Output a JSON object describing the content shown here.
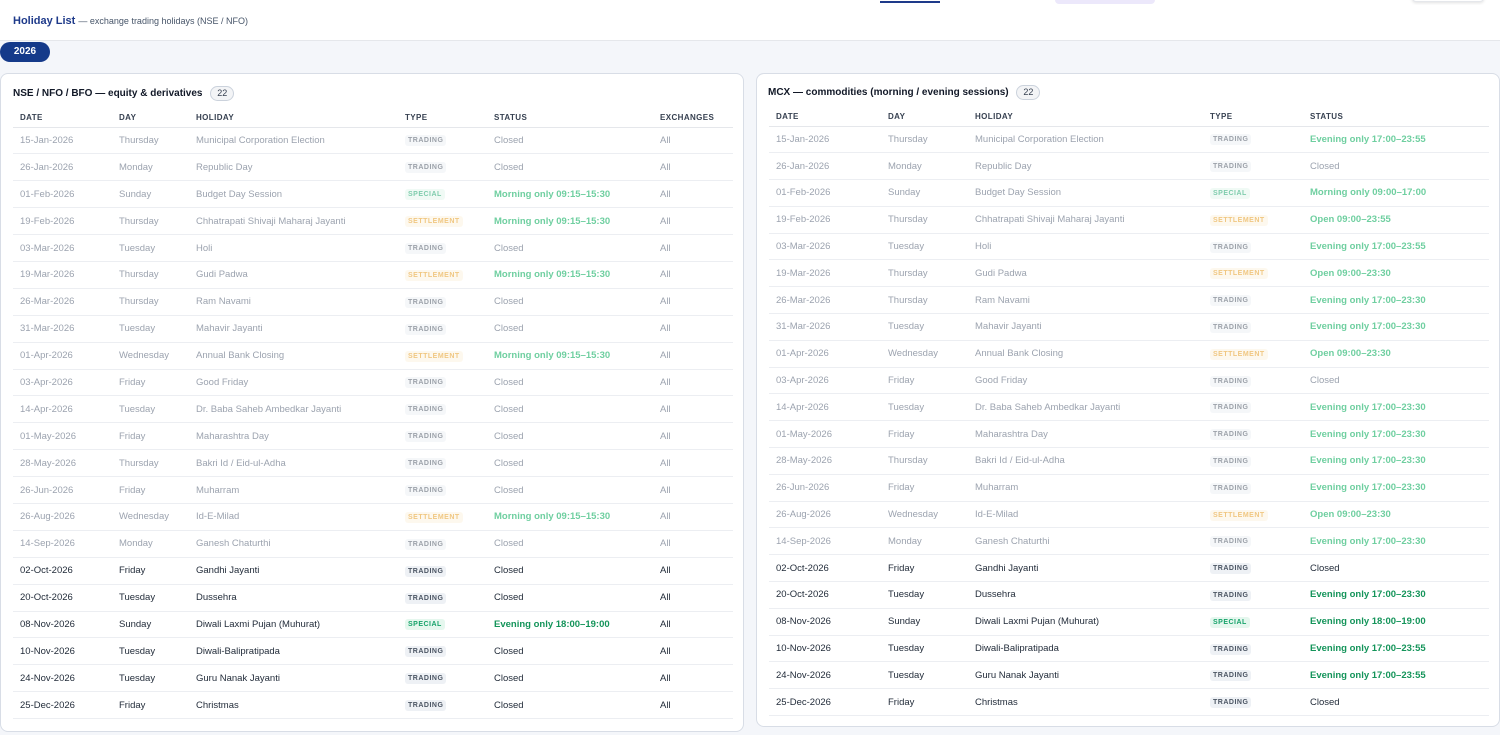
{
  "header": {
    "title": "Holiday List",
    "subtitle": "— exchange trading holidays (NSE / NFO)"
  },
  "year": "2026",
  "columns": {
    "date": "DATE",
    "day": "DAY",
    "holiday": "HOLIDAY",
    "type": "TYPE",
    "status": "STATUS",
    "exchanges": "EXCHANGES"
  },
  "nse": {
    "title": "NSE / NFO / BFO — equity & derivatives",
    "count": "22",
    "rows": [
      {
        "date": "15-Jan-2026",
        "day": "Thursday",
        "holiday": "Municipal Corporation Election",
        "type": "TRADING",
        "status": "Closed",
        "exchanges": "All",
        "past": true,
        "open": false
      },
      {
        "date": "26-Jan-2026",
        "day": "Monday",
        "holiday": "Republic Day",
        "type": "TRADING",
        "status": "Closed",
        "exchanges": "All",
        "past": true,
        "open": false
      },
      {
        "date": "01-Feb-2026",
        "day": "Sunday",
        "holiday": "Budget Day Session",
        "type": "SPECIAL",
        "status": "Morning only 09:15–15:30",
        "exchanges": "All",
        "past": true,
        "open": true
      },
      {
        "date": "19-Feb-2026",
        "day": "Thursday",
        "holiday": "Chhatrapati Shivaji Maharaj Jayanti",
        "type": "SETTLEMENT",
        "status": "Morning only 09:15–15:30",
        "exchanges": "All",
        "past": true,
        "open": true
      },
      {
        "date": "03-Mar-2026",
        "day": "Tuesday",
        "holiday": "Holi",
        "type": "TRADING",
        "status": "Closed",
        "exchanges": "All",
        "past": true,
        "open": false
      },
      {
        "date": "19-Mar-2026",
        "day": "Thursday",
        "holiday": "Gudi Padwa",
        "type": "SETTLEMENT",
        "status": "Morning only 09:15–15:30",
        "exchanges": "All",
        "past": true,
        "open": true
      },
      {
        "date": "26-Mar-2026",
        "day": "Thursday",
        "holiday": "Ram Navami",
        "type": "TRADING",
        "status": "Closed",
        "exchanges": "All",
        "past": true,
        "open": false
      },
      {
        "date": "31-Mar-2026",
        "day": "Tuesday",
        "holiday": "Mahavir Jayanti",
        "type": "TRADING",
        "status": "Closed",
        "exchanges": "All",
        "past": true,
        "open": false
      },
      {
        "date": "01-Apr-2026",
        "day": "Wednesday",
        "holiday": "Annual Bank Closing",
        "type": "SETTLEMENT",
        "status": "Morning only 09:15–15:30",
        "exchanges": "All",
        "past": true,
        "open": true
      },
      {
        "date": "03-Apr-2026",
        "day": "Friday",
        "holiday": "Good Friday",
        "type": "TRADING",
        "status": "Closed",
        "exchanges": "All",
        "past": true,
        "open": false
      },
      {
        "date": "14-Apr-2026",
        "day": "Tuesday",
        "holiday": "Dr. Baba Saheb Ambedkar Jayanti",
        "type": "TRADING",
        "status": "Closed",
        "exchanges": "All",
        "past": true,
        "open": false
      },
      {
        "date": "01-May-2026",
        "day": "Friday",
        "holiday": "Maharashtra Day",
        "type": "TRADING",
        "status": "Closed",
        "exchanges": "All",
        "past": true,
        "open": false
      },
      {
        "date": "28-May-2026",
        "day": "Thursday",
        "holiday": "Bakri Id / Eid-ul-Adha",
        "type": "TRADING",
        "status": "Closed",
        "exchanges": "All",
        "past": true,
        "open": false
      },
      {
        "date": "26-Jun-2026",
        "day": "Friday",
        "holiday": "Muharram",
        "type": "TRADING",
        "status": "Closed",
        "exchanges": "All",
        "past": true,
        "open": false
      },
      {
        "date": "26-Aug-2026",
        "day": "Wednesday",
        "holiday": "Id-E-Milad",
        "type": "SETTLEMENT",
        "status": "Morning only 09:15–15:30",
        "exchanges": "All",
        "past": true,
        "open": true
      },
      {
        "date": "14-Sep-2026",
        "day": "Monday",
        "holiday": "Ganesh Chaturthi",
        "type": "TRADING",
        "status": "Closed",
        "exchanges": "All",
        "past": true,
        "open": false
      },
      {
        "date": "02-Oct-2026",
        "day": "Friday",
        "holiday": "Gandhi Jayanti",
        "type": "TRADING",
        "status": "Closed",
        "exchanges": "All",
        "past": false,
        "open": false
      },
      {
        "date": "20-Oct-2026",
        "day": "Tuesday",
        "holiday": "Dussehra",
        "type": "TRADING",
        "status": "Closed",
        "exchanges": "All",
        "past": false,
        "open": false
      },
      {
        "date": "08-Nov-2026",
        "day": "Sunday",
        "holiday": "Diwali Laxmi Pujan (Muhurat)",
        "type": "SPECIAL",
        "status": "Evening only 18:00–19:00",
        "exchanges": "All",
        "past": false,
        "open": true
      },
      {
        "date": "10-Nov-2026",
        "day": "Tuesday",
        "holiday": "Diwali-Balipratipada",
        "type": "TRADING",
        "status": "Closed",
        "exchanges": "All",
        "past": false,
        "open": false
      },
      {
        "date": "24-Nov-2026",
        "day": "Tuesday",
        "holiday": "Guru Nanak Jayanti",
        "type": "TRADING",
        "status": "Closed",
        "exchanges": "All",
        "past": false,
        "open": false
      },
      {
        "date": "25-Dec-2026",
        "day": "Friday",
        "holiday": "Christmas",
        "type": "TRADING",
        "status": "Closed",
        "exchanges": "All",
        "past": false,
        "open": false
      }
    ]
  },
  "mcx": {
    "title": "MCX — commodities (morning / evening sessions)",
    "count": "22",
    "rows": [
      {
        "date": "15-Jan-2026",
        "day": "Thursday",
        "holiday": "Municipal Corporation Election",
        "type": "TRADING",
        "status": "Evening only 17:00–23:55",
        "past": true,
        "open": true
      },
      {
        "date": "26-Jan-2026",
        "day": "Monday",
        "holiday": "Republic Day",
        "type": "TRADING",
        "status": "Closed",
        "past": true,
        "open": false
      },
      {
        "date": "01-Feb-2026",
        "day": "Sunday",
        "holiday": "Budget Day Session",
        "type": "SPECIAL",
        "status": "Morning only 09:00–17:00",
        "past": true,
        "open": true
      },
      {
        "date": "19-Feb-2026",
        "day": "Thursday",
        "holiday": "Chhatrapati Shivaji Maharaj Jayanti",
        "type": "SETTLEMENT",
        "status": "Open 09:00–23:55",
        "past": true,
        "open": true
      },
      {
        "date": "03-Mar-2026",
        "day": "Tuesday",
        "holiday": "Holi",
        "type": "TRADING",
        "status": "Evening only 17:00–23:55",
        "past": true,
        "open": true
      },
      {
        "date": "19-Mar-2026",
        "day": "Thursday",
        "holiday": "Gudi Padwa",
        "type": "SETTLEMENT",
        "status": "Open 09:00–23:30",
        "past": true,
        "open": true
      },
      {
        "date": "26-Mar-2026",
        "day": "Thursday",
        "holiday": "Ram Navami",
        "type": "TRADING",
        "status": "Evening only 17:00–23:30",
        "past": true,
        "open": true
      },
      {
        "date": "31-Mar-2026",
        "day": "Tuesday",
        "holiday": "Mahavir Jayanti",
        "type": "TRADING",
        "status": "Evening only 17:00–23:30",
        "past": true,
        "open": true
      },
      {
        "date": "01-Apr-2026",
        "day": "Wednesday",
        "holiday": "Annual Bank Closing",
        "type": "SETTLEMENT",
        "status": "Open 09:00–23:30",
        "past": true,
        "open": true
      },
      {
        "date": "03-Apr-2026",
        "day": "Friday",
        "holiday": "Good Friday",
        "type": "TRADING",
        "status": "Closed",
        "past": true,
        "open": false
      },
      {
        "date": "14-Apr-2026",
        "day": "Tuesday",
        "holiday": "Dr. Baba Saheb Ambedkar Jayanti",
        "type": "TRADING",
        "status": "Evening only 17:00–23:30",
        "past": true,
        "open": true
      },
      {
        "date": "01-May-2026",
        "day": "Friday",
        "holiday": "Maharashtra Day",
        "type": "TRADING",
        "status": "Evening only 17:00–23:30",
        "past": true,
        "open": true
      },
      {
        "date": "28-May-2026",
        "day": "Thursday",
        "holiday": "Bakri Id / Eid-ul-Adha",
        "type": "TRADING",
        "status": "Evening only 17:00–23:30",
        "past": true,
        "open": true
      },
      {
        "date": "26-Jun-2026",
        "day": "Friday",
        "holiday": "Muharram",
        "type": "TRADING",
        "status": "Evening only 17:00–23:30",
        "past": true,
        "open": true
      },
      {
        "date": "26-Aug-2026",
        "day": "Wednesday",
        "holiday": "Id-E-Milad",
        "type": "SETTLEMENT",
        "status": "Open 09:00–23:30",
        "past": true,
        "open": true
      },
      {
        "date": "14-Sep-2026",
        "day": "Monday",
        "holiday": "Ganesh Chaturthi",
        "type": "TRADING",
        "status": "Evening only 17:00–23:30",
        "past": true,
        "open": true
      },
      {
        "date": "02-Oct-2026",
        "day": "Friday",
        "holiday": "Gandhi Jayanti",
        "type": "TRADING",
        "status": "Closed",
        "past": false,
        "open": false
      },
      {
        "date": "20-Oct-2026",
        "day": "Tuesday",
        "holiday": "Dussehra",
        "type": "TRADING",
        "status": "Evening only 17:00–23:30",
        "past": false,
        "open": true
      },
      {
        "date": "08-Nov-2026",
        "day": "Sunday",
        "holiday": "Diwali Laxmi Pujan (Muhurat)",
        "type": "SPECIAL",
        "status": "Evening only 18:00–19:00",
        "past": false,
        "open": true
      },
      {
        "date": "10-Nov-2026",
        "day": "Tuesday",
        "holiday": "Diwali-Balipratipada",
        "type": "TRADING",
        "status": "Evening only 17:00–23:55",
        "past": false,
        "open": true
      },
      {
        "date": "24-Nov-2026",
        "day": "Tuesday",
        "holiday": "Guru Nanak Jayanti",
        "type": "TRADING",
        "status": "Evening only 17:00–23:55",
        "past": false,
        "open": true
      },
      {
        "date": "25-Dec-2026",
        "day": "Friday",
        "holiday": "Christmas",
        "type": "TRADING",
        "status": "Closed",
        "past": false,
        "open": false
      }
    ]
  }
}
